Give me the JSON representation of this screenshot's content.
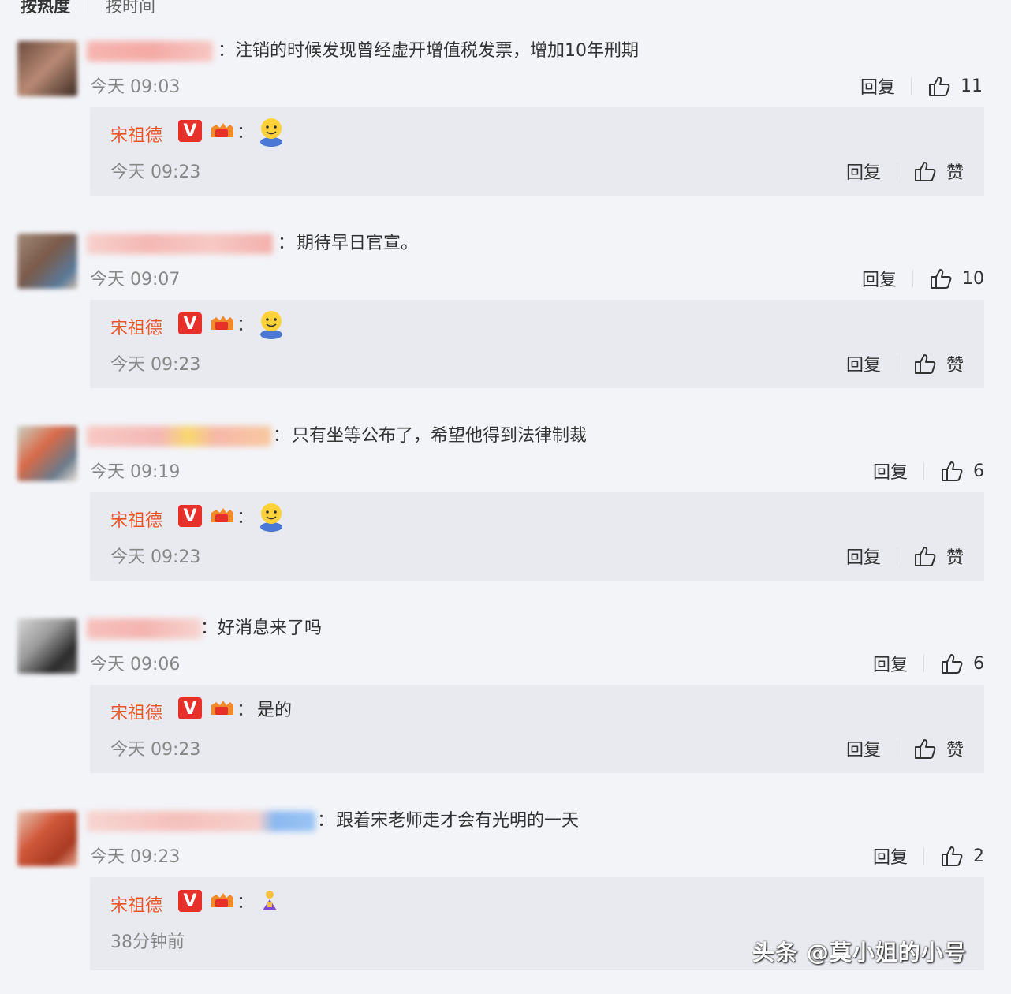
{
  "tabs": [
    {
      "label": "按热度"
    },
    {
      "label": "按时间"
    }
  ],
  "labels": {
    "reply": "回复",
    "like": "赞",
    "colon": "："
  },
  "comments": [
    {
      "text": "注销的时候发现曾经虚开增值税发票，增加10年刑期",
      "time": "今天 09:03",
      "likes": "11",
      "reply": {
        "name": "宋祖德",
        "text": "",
        "emoji": "face-emoji",
        "time": "今天 09:23"
      }
    },
    {
      "text": "期待早日官宣。",
      "time": "今天 09:07",
      "likes": "10",
      "reply": {
        "name": "宋祖德",
        "text": "",
        "emoji": "face-emoji",
        "time": "今天 09:23"
      }
    },
    {
      "text": "只有坐等公布了，希望他得到法律制裁",
      "time": "今天 09:19",
      "likes": "6",
      "reply": {
        "name": "宋祖德",
        "text": "",
        "emoji": "face-emoji",
        "time": "今天 09:23"
      }
    },
    {
      "text": "好消息来了吗",
      "time": "今天 09:06",
      "likes": "6",
      "reply": {
        "name": "宋祖德",
        "text": "是的",
        "emoji": "",
        "time": "今天 09:23"
      }
    },
    {
      "text": "跟着宋老师走才会有光明的一天",
      "time": "今天 09:23",
      "likes": "2",
      "reply": {
        "name": "宋祖德",
        "text": "",
        "emoji": "bow-emoji",
        "time": "38分钟前"
      }
    }
  ],
  "watermark": "头条 @莫小姐的小号",
  "colors": {
    "accent_name": "#e8562a",
    "badge_red": "#e8302a",
    "background": "#f3f4f8",
    "reply_bg": "#e9eaf0"
  }
}
